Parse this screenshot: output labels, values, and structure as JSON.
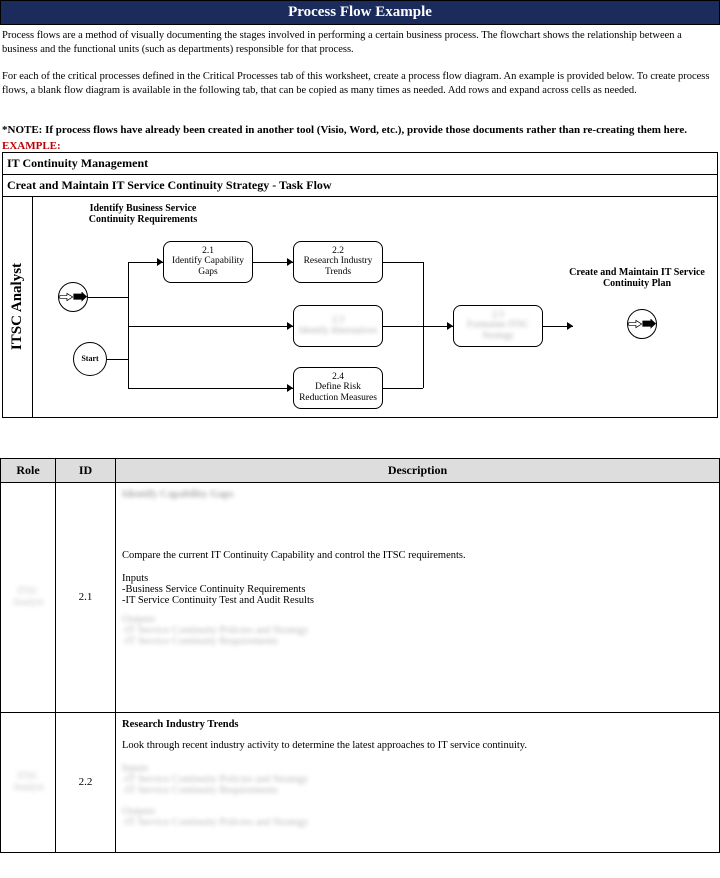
{
  "header": {
    "title": "Process Flow Example"
  },
  "intro": {
    "p1": "Process flows are a method of visually documenting the stages involved in performing a certain business process.   The flowchart shows the relationship between a business and the functional units (such as departments) responsible for that process.",
    "p2": "For each of the critical processes defined in the Critical Processes tab of this worksheet, create a process flow diagram.  An example is provided below.  To create process flows, a blank flow diagram is available in the following tab, that can be copied as many times as needed.   Add rows and expand across cells as needed.",
    "note": "*NOTE:  If process flows have already been created in another tool (Visio, Word, etc.), provide those documents rather than re-creating them here.",
    "example_label": "EXAMPLE:"
  },
  "flow": {
    "section_title": "IT  Continuity Management",
    "subtitle": "Creat and Maintain IT Service Continuity Strategy - Task Flow",
    "swimlane": "ITSC Analyst",
    "input_label": "Identify Business Service Continuity Requirements",
    "start_label": "Start",
    "tasks": {
      "t21": {
        "num": "2.1",
        "name": "Identify Capability Gaps"
      },
      "t22": {
        "num": "2.2",
        "name": "Research Industry Trends"
      },
      "t23": {
        "num": "2.3",
        "name": "Identify Alternatives"
      },
      "t24": {
        "num": "2.4",
        "name": "Define Risk Reduction Measures"
      },
      "t25": {
        "num": "2.5",
        "name": "Formulate ITSC Strategy"
      }
    },
    "output_label": "Create and Maintain IT Service Continuity Plan"
  },
  "table": {
    "headers": {
      "role": "Role",
      "id": "ID",
      "desc": "Description"
    },
    "rows": [
      {
        "role": "ITSC Analyst",
        "id": "2.1",
        "title": "Identify Capability Gaps",
        "body": "Compare the current IT Continuity Capability and control the ITSC requirements.",
        "inputs_label": "Inputs",
        "inputs": [
          "-Business Service Continuity Requirements",
          "-IT Service Continuity Test and Audit Results"
        ],
        "outputs_label": "Outputs",
        "outputs": [
          "-IT Service Continuity Policies and Strategy",
          "-IT Service Continuity Requirements"
        ]
      },
      {
        "role": "ITSC Analyst",
        "id": "2.2",
        "title": "Research Industry Trends",
        "body": "Look through recent industry activity to determine the latest approaches to IT service continuity.",
        "inputs_label": "Inputs",
        "inputs": [
          "-IT Service Continuity Policies and Strategy",
          "-IT Service Continuity Requirements"
        ],
        "outputs_label": "Outputs",
        "outputs": [
          "-IT Service Continuity Policies and Strategy"
        ]
      }
    ]
  }
}
